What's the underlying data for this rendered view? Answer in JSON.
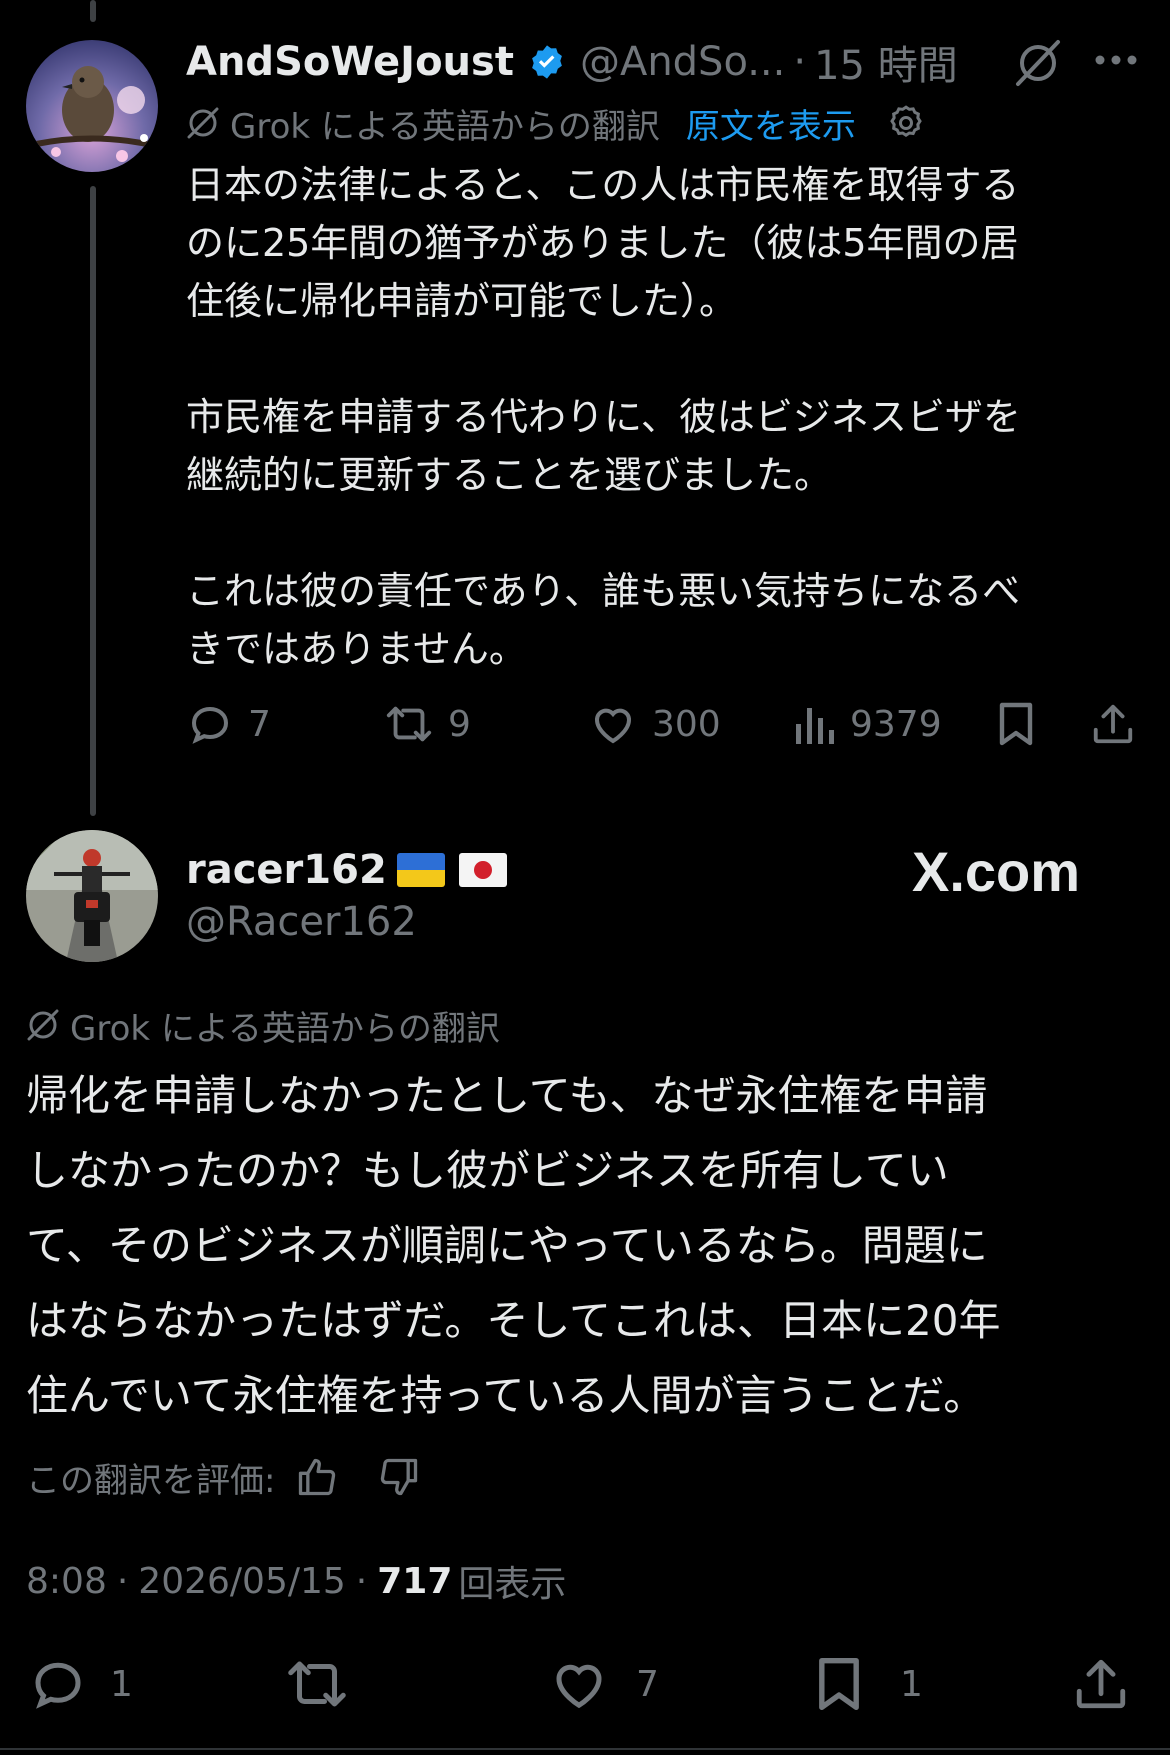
{
  "parent_post": {
    "display_name": "AndSoWeJoust",
    "handle": "@AndSo...",
    "separator": "·",
    "time_ago": "15 時間",
    "translation_label": "Grok による英語からの翻訳",
    "show_original_label": "原文を表示",
    "body": "日本の法律によると、この人は市民権を取得する\nのに25年間の猶予がありました（彼は5年間の居\n住後に帰化申請が可能でした）。\n\n市民権を申請する代わりに、彼はビジネスビザを\n継続的に更新することを選びました。\n\nこれは彼の責任であり、誰も悪い気持ちになるべ\nきではありません。",
    "stats": {
      "replies": "7",
      "reposts": "9",
      "likes": "300",
      "views": "9379"
    }
  },
  "main_post": {
    "display_name": "racer162",
    "flags": [
      "ukraine-flag",
      "japan-flag"
    ],
    "handle": "@Racer162",
    "watermark": "X.com",
    "translation_label": "Grok による英語からの翻訳",
    "body": "帰化を申請しなかったとしても、なぜ永住権を申請\nしなかったのか？もし彼がビジネスを所有してい\nて、そのビジネスが順調にやっているなら。問題に\nはならなかったはずだ。そしてこれは、日本に20年\n住んでいて永住権を持っている人間が言うことだ。",
    "rate_translation_label": "この翻訳を評価:",
    "timestamp_time": "8:08",
    "timestamp_sep1": "·",
    "timestamp_date": "2026/05/15",
    "timestamp_sep2": "·",
    "views_count": "717",
    "views_label": "回表示",
    "stats": {
      "replies": "1",
      "likes": "7",
      "bookmarks": "1"
    }
  },
  "colors": {
    "background": "#000000",
    "text": "#e7e9ea",
    "muted": "#71767b",
    "link": "#1d9bf0",
    "verified": "#1d9bf0"
  }
}
